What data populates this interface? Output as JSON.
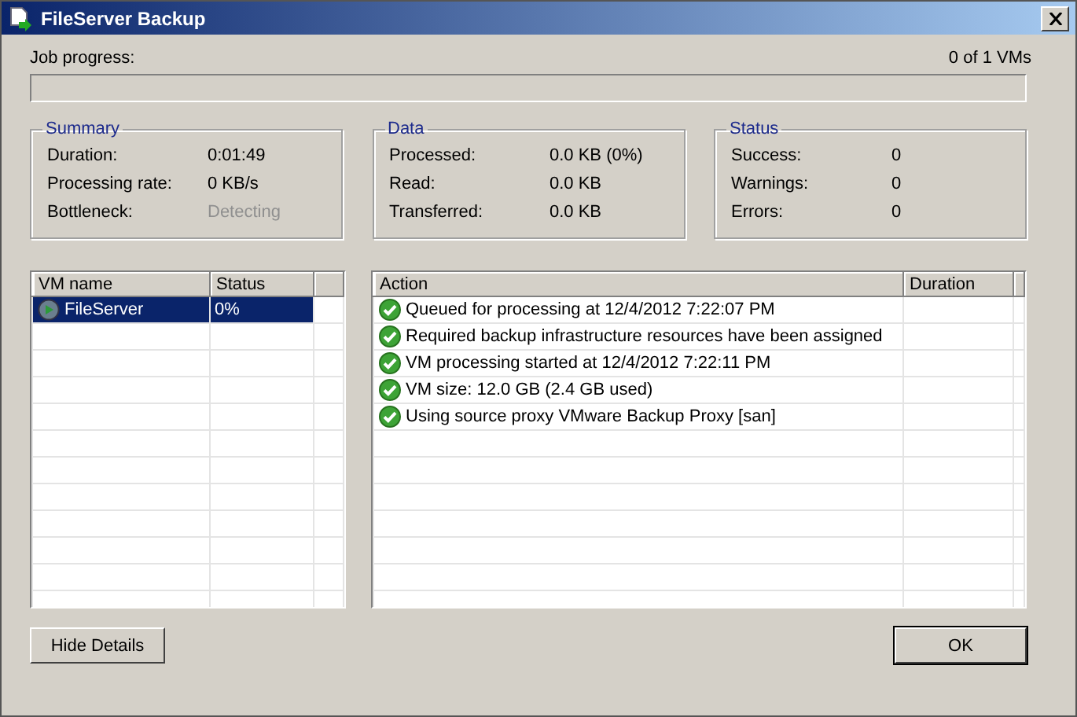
{
  "window": {
    "title": "FileServer Backup"
  },
  "job_progress": {
    "label": "Job progress:",
    "count": "0 of 1 VMs",
    "level": 0
  },
  "groups": [
    {
      "title": "Summary",
      "rows": [
        {
          "label": "Duration:",
          "value": "0:01:49",
          "disabled": false
        },
        {
          "label": "Processing rate:",
          "value": "0 KB/s",
          "disabled": false
        },
        {
          "label": "Bottleneck:",
          "value": "Detecting",
          "disabled": true
        }
      ]
    },
    {
      "title": "Data",
      "rows": [
        {
          "label": "Processed:",
          "value": "0.0 KB (0%)",
          "disabled": false
        },
        {
          "label": "Read:",
          "value": "0.0 KB",
          "disabled": false
        },
        {
          "label": "Transferred:",
          "value": "0.0 KB",
          "disabled": false
        }
      ]
    },
    {
      "title": "Status",
      "rows": [
        {
          "label": "Success:",
          "value": "0",
          "disabled": false
        },
        {
          "label": "Warnings:",
          "value": "0",
          "disabled": false
        },
        {
          "label": "Errors:",
          "value": "0",
          "disabled": false
        }
      ]
    }
  ],
  "vm_table": {
    "columns": [
      "VM name",
      "Status"
    ],
    "rows": [
      {
        "name": "FileServer",
        "status": "0%",
        "selected": true
      }
    ]
  },
  "action_table": {
    "columns": [
      "Action",
      "Duration"
    ],
    "rows": [
      {
        "action": "Queued for processing at 12/4/2012 7:22:07 PM"
      },
      {
        "action": "Required backup infrastructure resources have been assigned"
      },
      {
        "action": "VM processing started at 12/4/2012 7:22:11 PM"
      },
      {
        "action": "VM size: 12.0 GB (2.4 GB used)"
      },
      {
        "action": "Using source proxy VMware Backup Proxy [san]"
      }
    ]
  },
  "buttons": [
    {
      "label": "Hide Details",
      "default": false
    },
    {
      "label": "OK",
      "default": true
    }
  ]
}
